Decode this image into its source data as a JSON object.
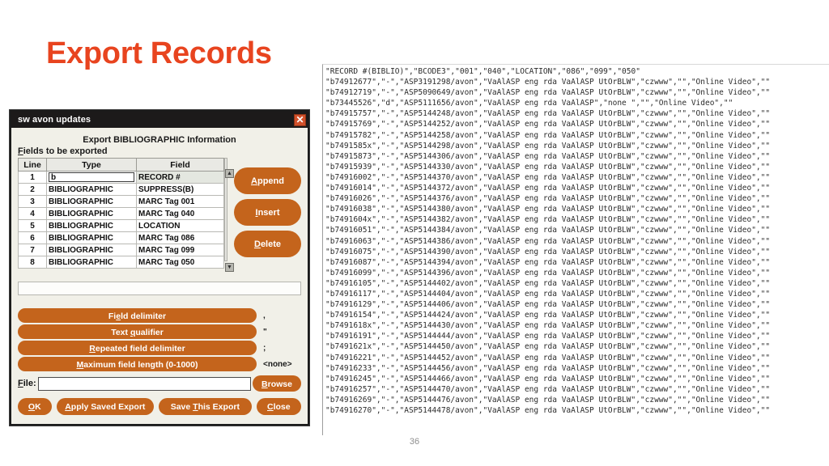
{
  "slide": {
    "title": "Export Records",
    "number": "36",
    "title_color": "#e8441f"
  },
  "dialog": {
    "window_title": "sw avon updates",
    "close_icon": "close-x-icon",
    "panel_title": "Export BIBLIOGRAPHIC Information",
    "subhead": "Fields to be exported",
    "grid": {
      "columns": [
        "Line",
        "Type",
        "Field"
      ],
      "rows": [
        {
          "line": "1",
          "type": "b",
          "field": "RECORD #",
          "editing": true
        },
        {
          "line": "2",
          "type": "BIBLIOGRAPHIC",
          "field": "SUPPRESS(B)"
        },
        {
          "line": "3",
          "type": "BIBLIOGRAPHIC",
          "field": "MARC Tag 001"
        },
        {
          "line": "4",
          "type": "BIBLIOGRAPHIC",
          "field": "MARC Tag 040"
        },
        {
          "line": "5",
          "type": "BIBLIOGRAPHIC",
          "field": "LOCATION"
        },
        {
          "line": "6",
          "type": "BIBLIOGRAPHIC",
          "field": "MARC Tag 086"
        },
        {
          "line": "7",
          "type": "BIBLIOGRAPHIC",
          "field": "MARC Tag 099"
        },
        {
          "line": "8",
          "type": "BIBLIOGRAPHIC",
          "field": "MARC Tag 050"
        }
      ]
    },
    "side_buttons": [
      {
        "label": "Append"
      },
      {
        "label": "Insert"
      },
      {
        "label": "Delete"
      }
    ],
    "free_text_value": "",
    "options": [
      {
        "label": "Field delimiter",
        "value": ","
      },
      {
        "label": "Text qualifier",
        "value": "\""
      },
      {
        "label": "Repeated field delimiter",
        "value": ";"
      },
      {
        "label": "Maximum field length (0-1000)",
        "value": "<none>"
      }
    ],
    "file_row": {
      "label": "File:",
      "value": "",
      "browse_label": "Browse"
    },
    "bottom_buttons": [
      {
        "label": "OK"
      },
      {
        "label": "Apply Saved Export"
      },
      {
        "label": "Save This Export"
      },
      {
        "label": "Close"
      }
    ],
    "accent_color": "#c4641c",
    "titlebar_color": "#1c1a1a"
  },
  "data_panel": {
    "lines": [
      "\"RECORD #(BIBLIO)\",\"BCODE3\",\"001\",\"040\",\"LOCATION\",\"086\",\"099\",\"050\"",
      "\"b74912677\",\"-\",\"ASP3191298/avon\",\"VaAlASP eng rda VaAlASP UtOrBLW\",\"czwww\",\"\",\"Online Video\",\"\"",
      "\"b74912719\",\"-\",\"ASP5090649/avon\",\"VaAlASP eng rda VaAlASP UtOrBLW\",\"czwww\",\"\",\"Online Video\",\"\"",
      "\"b73445526\",\"d\",\"ASP5111656/avon\",\"VaAlASP eng rda VaAlASP\",\"none \",\"\",\"Online Video\",\"\"",
      "\"b74915757\",\"-\",\"ASP5144248/avon\",\"VaAlASP eng rda VaAlASP UtOrBLW\",\"czwww\",\"\",\"Online Video\",\"\"",
      "\"b74915769\",\"-\",\"ASP5144252/avon\",\"VaAlASP eng rda VaAlASP UtOrBLW\",\"czwww\",\"\",\"Online Video\",\"\"",
      "\"b74915782\",\"-\",\"ASP5144258/avon\",\"VaAlASP eng rda VaAlASP UtOrBLW\",\"czwww\",\"\",\"Online Video\",\"\"",
      "\"b7491585x\",\"-\",\"ASP5144298/avon\",\"VaAlASP eng rda VaAlASP UtOrBLW\",\"czwww\",\"\",\"Online Video\",\"\"",
      "\"b74915873\",\"-\",\"ASP5144306/avon\",\"VaAlASP eng rda VaAlASP UtOrBLW\",\"czwww\",\"\",\"Online Video\",\"\"",
      "\"b74915939\",\"-\",\"ASP5144330/avon\",\"VaAlASP eng rda VaAlASP UtOrBLW\",\"czwww\",\"\",\"Online Video\",\"\"",
      "\"b74916002\",\"-\",\"ASP5144370/avon\",\"VaAlASP eng rda VaAlASP UtOrBLW\",\"czwww\",\"\",\"Online Video\",\"\"",
      "\"b74916014\",\"-\",\"ASP5144372/avon\",\"VaAlASP eng rda VaAlASP UtOrBLW\",\"czwww\",\"\",\"Online Video\",\"\"",
      "\"b74916026\",\"-\",\"ASP5144376/avon\",\"VaAlASP eng rda VaAlASP UtOrBLW\",\"czwww\",\"\",\"Online Video\",\"\"",
      "\"b74916038\",\"-\",\"ASP5144380/avon\",\"VaAlASP eng rda VaAlASP UtOrBLW\",\"czwww\",\"\",\"Online Video\",\"\"",
      "\"b7491604x\",\"-\",\"ASP5144382/avon\",\"VaAlASP eng rda VaAlASP UtOrBLW\",\"czwww\",\"\",\"Online Video\",\"\"",
      "\"b74916051\",\"-\",\"ASP5144384/avon\",\"VaAlASP eng rda VaAlASP UtOrBLW\",\"czwww\",\"\",\"Online Video\",\"\"",
      "\"b74916063\",\"-\",\"ASP5144386/avon\",\"VaAlASP eng rda VaAlASP UtOrBLW\",\"czwww\",\"\",\"Online Video\",\"\"",
      "\"b74916075\",\"-\",\"ASP5144390/avon\",\"VaAlASP eng rda VaAlASP UtOrBLW\",\"czwww\",\"\",\"Online Video\",\"\"",
      "\"b74916087\",\"-\",\"ASP5144394/avon\",\"VaAlASP eng rda VaAlASP UtOrBLW\",\"czwww\",\"\",\"Online Video\",\"\"",
      "\"b74916099\",\"-\",\"ASP5144396/avon\",\"VaAlASP eng rda VaAlASP UtOrBLW\",\"czwww\",\"\",\"Online Video\",\"\"",
      "\"b74916105\",\"-\",\"ASP5144402/avon\",\"VaAlASP eng rda VaAlASP UtOrBLW\",\"czwww\",\"\",\"Online Video\",\"\"",
      "\"b74916117\",\"-\",\"ASP5144404/avon\",\"VaAlASP eng rda VaAlASP UtOrBLW\",\"czwww\",\"\",\"Online Video\",\"\"",
      "\"b74916129\",\"-\",\"ASP5144406/avon\",\"VaAlASP eng rda VaAlASP UtOrBLW\",\"czwww\",\"\",\"Online Video\",\"\"",
      "\"b74916154\",\"-\",\"ASP5144424/avon\",\"VaAlASP eng rda VaAlASP UtOrBLW\",\"czwww\",\"\",\"Online Video\",\"\"",
      "\"b7491618x\",\"-\",\"ASP5144430/avon\",\"VaAlASP eng rda VaAlASP UtOrBLW\",\"czwww\",\"\",\"Online Video\",\"\"",
      "\"b74916191\",\"-\",\"ASP5144444/avon\",\"VaAlASP eng rda VaAlASP UtOrBLW\",\"czwww\",\"\",\"Online Video\",\"\"",
      "\"b7491621x\",\"-\",\"ASP5144450/avon\",\"VaAlASP eng rda VaAlASP UtOrBLW\",\"czwww\",\"\",\"Online Video\",\"\"",
      "\"b74916221\",\"-\",\"ASP5144452/avon\",\"VaAlASP eng rda VaAlASP UtOrBLW\",\"czwww\",\"\",\"Online Video\",\"\"",
      "\"b74916233\",\"-\",\"ASP5144456/avon\",\"VaAlASP eng rda VaAlASP UtOrBLW\",\"czwww\",\"\",\"Online Video\",\"\"",
      "\"b74916245\",\"-\",\"ASP5144466/avon\",\"VaAlASP eng rda VaAlASP UtOrBLW\",\"czwww\",\"\",\"Online Video\",\"\"",
      "\"b74916257\",\"-\",\"ASP5144470/avon\",\"VaAlASP eng rda VaAlASP UtOrBLW\",\"czwww\",\"\",\"Online Video\",\"\"",
      "\"b74916269\",\"-\",\"ASP5144476/avon\",\"VaAlASP eng rda VaAlASP UtOrBLW\",\"czwww\",\"\",\"Online Video\",\"\"",
      "\"b74916270\",\"-\",\"ASP5144478/avon\",\"VaAlASP eng rda VaAlASP UtOrBLW\",\"czwww\",\"\",\"Online Video\",\"\""
    ]
  }
}
